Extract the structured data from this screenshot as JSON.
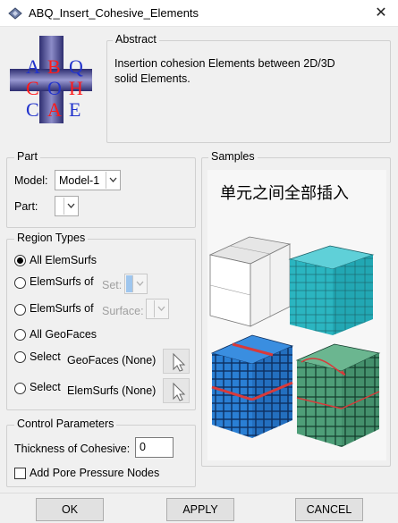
{
  "window": {
    "title": "ABQ_Insert_Cohesive_Elements",
    "close_symbol": "✕"
  },
  "logo": {
    "letters": [
      "A",
      "B",
      "Q",
      "C",
      "O",
      "H",
      "C",
      "A",
      "E"
    ],
    "letter_color": "#ff1a1a",
    "letter_color_alt": "#2233cc",
    "cross_color": "#3c3c8c"
  },
  "abstract": {
    "label": "Abstract",
    "text": "Insertion cohesion Elements between 2D/3D solid Elements."
  },
  "part": {
    "label": "Part",
    "model_label": "Model:",
    "model_value": "Model-1",
    "part_label": "Part:",
    "part_value": ""
  },
  "samples": {
    "label": "Samples",
    "heading": "单元之间全部插入"
  },
  "region_types": {
    "label": "Region Types",
    "options": {
      "all_elemsurfs": "All ElemSurfs",
      "elemsurfs_of_set": "ElemSurfs of",
      "set_label": "Set:",
      "elemsurfs_of_surface": "ElemSurfs of",
      "surface_label": "Surface:",
      "all_geofaces": "All GeoFaces",
      "select_geofaces": "Select",
      "geofaces_status": "GeoFaces (None)",
      "select_elemsurfs": "Select",
      "elemsurfs_status": "ElemSurfs (None)"
    },
    "selected": "all_elemsurfs"
  },
  "control": {
    "label": "Control Parameters",
    "thickness_label": "Thickness of Cohesive:",
    "thickness_value": "0",
    "pore_label": "Add Pore Pressure Nodes",
    "pore_checked": false
  },
  "buttons": {
    "ok": "OK",
    "apply": "APPLY",
    "cancel": "CANCEL"
  },
  "colors": {
    "cube_teal": "#2bb5c0",
    "cube_blue": "#2a7fd4",
    "cohesive_red": "#d83a3a",
    "cube_green": "#4e9e78"
  }
}
